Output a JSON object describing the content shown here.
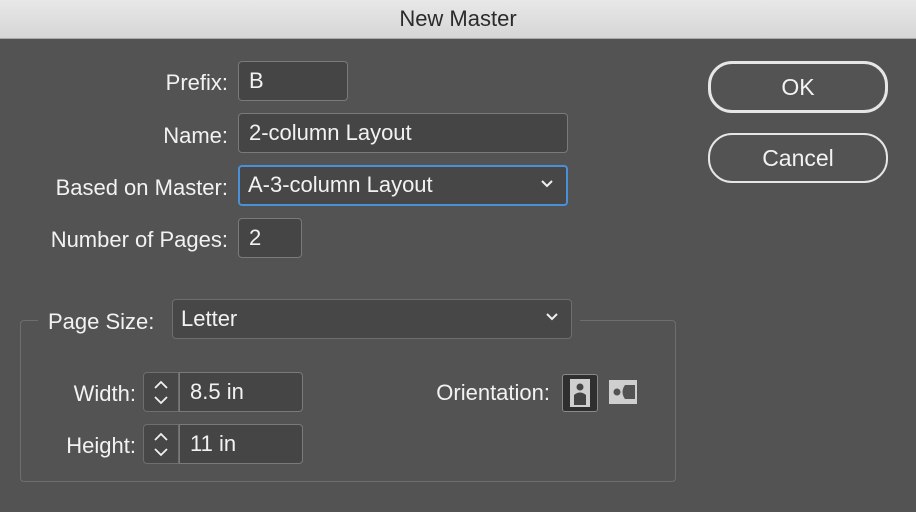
{
  "window": {
    "title": "New Master"
  },
  "form": {
    "prefix_label": "Prefix:",
    "prefix_value": "B",
    "name_label": "Name:",
    "name_value": "2-column Layout",
    "based_on_label": "Based on Master:",
    "based_on_value": "A-3-column Layout",
    "pages_label": "Number of Pages:",
    "pages_value": "2"
  },
  "page_size": {
    "label": "Page Size:",
    "value": "Letter",
    "width_label": "Width:",
    "width_value": "8.5 in",
    "height_label": "Height:",
    "height_value": "11 in",
    "orientation_label": "Orientation:",
    "orientation_selected": "portrait"
  },
  "buttons": {
    "ok": "OK",
    "cancel": "Cancel"
  },
  "colors": {
    "background": "#535353",
    "focus_ring": "#4a90d9",
    "titlebar": "#dcdcdc"
  },
  "icons": [
    "chevron-down-icon",
    "stepper-up-icon",
    "stepper-down-icon",
    "portrait-orientation-icon",
    "landscape-orientation-icon"
  ]
}
